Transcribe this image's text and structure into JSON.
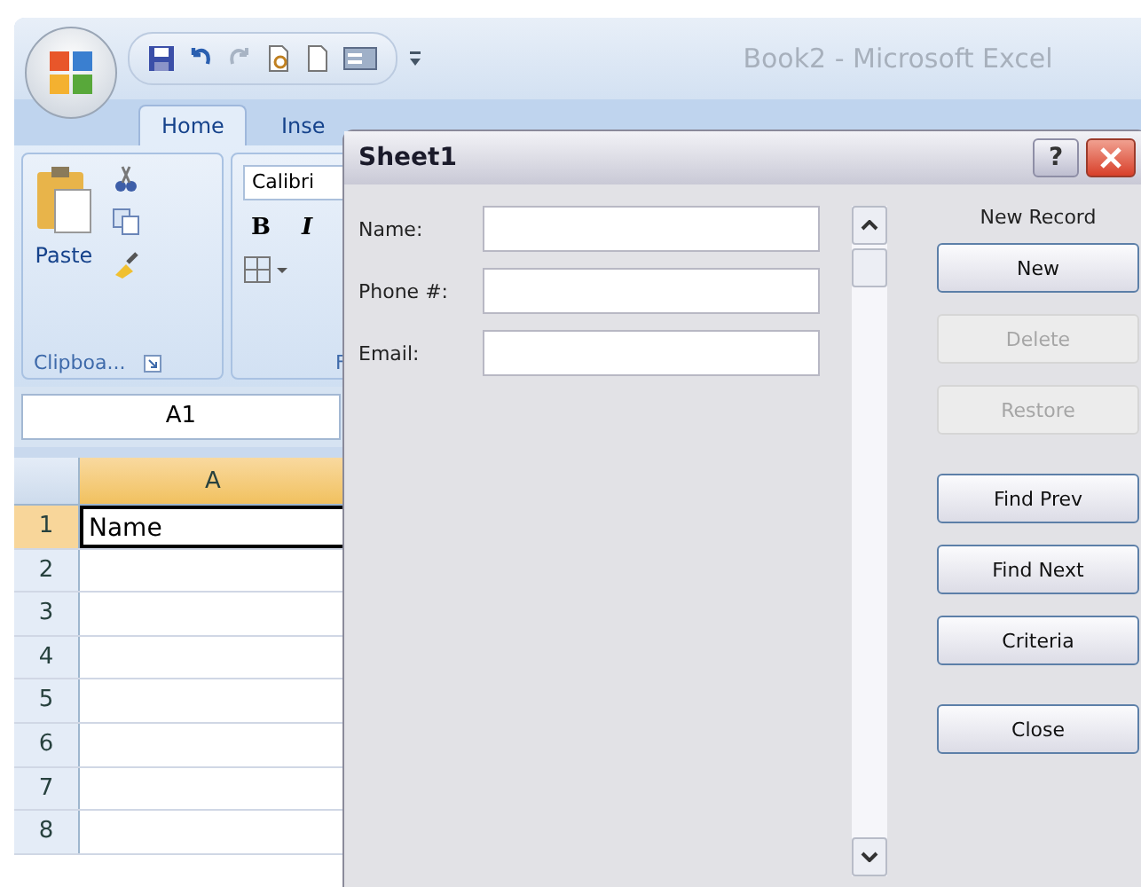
{
  "excel": {
    "title": "Book2 - Microsoft Excel",
    "ribbon_tabs": [
      {
        "label": "Home",
        "selected": true
      },
      {
        "label": "Inse",
        "selected": false
      }
    ],
    "clipboard": {
      "paste": "Paste",
      "group_label": "Clipboa..."
    },
    "font": {
      "name": "Calibri",
      "bold": "B",
      "italic": "I",
      "group_label": "F"
    },
    "name_box": "A1",
    "column_header": {
      "label": "A",
      "selected": true
    },
    "rows": [
      {
        "number": "1",
        "cell": "Name",
        "selected": true
      },
      {
        "number": "2",
        "selected": false
      },
      {
        "number": "3",
        "selected": false
      },
      {
        "number": "4",
        "selected": false
      },
      {
        "number": "5",
        "selected": false
      },
      {
        "number": "6",
        "selected": false
      },
      {
        "number": "7",
        "selected": false
      },
      {
        "number": "8",
        "selected": false
      }
    ]
  },
  "dialog": {
    "title": "Sheet1",
    "help": "?",
    "fields": [
      {
        "label": "Name:"
      },
      {
        "label": "Phone #:"
      },
      {
        "label": "Email:"
      }
    ],
    "record_status": "New Record",
    "button_groups": [
      [
        {
          "label": "New",
          "disabled": false
        },
        {
          "label": "Delete",
          "disabled": true
        },
        {
          "label": "Restore",
          "disabled": true
        }
      ],
      [
        {
          "label": "Find Prev",
          "disabled": false
        },
        {
          "label": "Find Next",
          "disabled": false
        },
        {
          "label": "Criteria",
          "disabled": false
        }
      ],
      [
        {
          "label": "Close",
          "disabled": false
        }
      ]
    ]
  }
}
